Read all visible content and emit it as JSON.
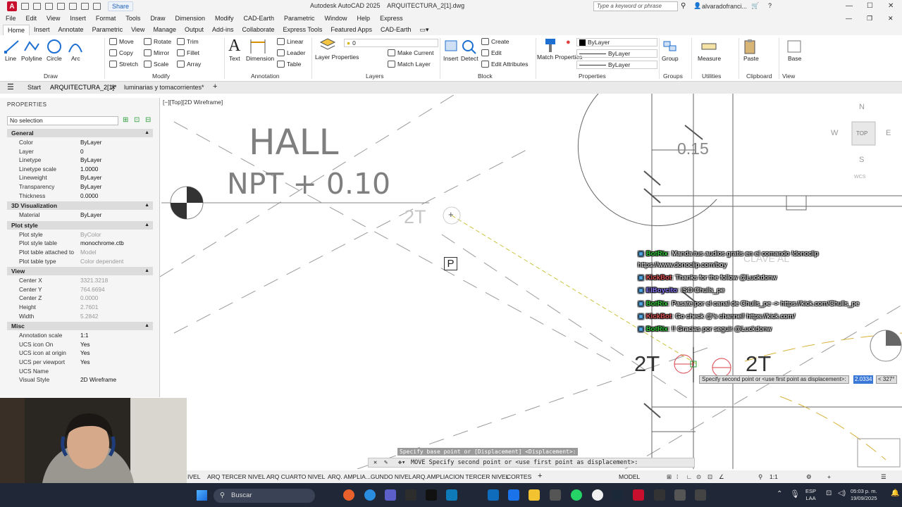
{
  "window": {
    "title": "Autodesk AutoCAD 2025    ARQUITECTURA_2[1].dwg",
    "share_label": "Share",
    "search_placeholder": "Type a keyword or phrase",
    "user": "alvaradofranci..."
  },
  "menu": [
    "File",
    "Edit",
    "View",
    "Insert",
    "Format",
    "Tools",
    "Draw",
    "Dimension",
    "Modify",
    "CAD-Earth",
    "Parametric",
    "Window",
    "Help",
    "Express"
  ],
  "ribbon_tabs": [
    "Home",
    "Insert",
    "Annotate",
    "Parametric",
    "View",
    "Manage",
    "Output",
    "Add-ins",
    "Collaborate",
    "Express Tools",
    "Featured Apps",
    "CAD-Earth"
  ],
  "ribbon": {
    "draw": {
      "line": "Line",
      "polyline": "Polyline",
      "circle": "Circle",
      "arc": "Arc",
      "label": "Draw"
    },
    "modify": {
      "move": "Move",
      "rotate": "Rotate",
      "trim": "Trim",
      "copy": "Copy",
      "mirror": "Mirror",
      "fillet": "Fillet",
      "stretch": "Stretch",
      "scale": "Scale",
      "array": "Array",
      "label": "Modify"
    },
    "annotation": {
      "text": "Text",
      "dimension": "Dimension",
      "linear": "Linear",
      "leader": "Leader",
      "table": "Table",
      "label": "Annotation"
    },
    "layers": {
      "layer_properties": "Layer Properties",
      "layer_value": "0",
      "make_current": "Make Current",
      "match_layer": "Match Layer",
      "label": "Layers"
    },
    "block": {
      "insert": "Insert",
      "detect": "Detect",
      "create": "Create",
      "edit": "Edit",
      "edit_attributes": "Edit Attributes",
      "label": "Block"
    },
    "properties": {
      "match_properties": "Match Properties",
      "color": "ByLayer",
      "lineweight": "ByLayer",
      "linetype": "ByLayer",
      "label": "Properties"
    },
    "groups": {
      "group": "Group",
      "label": "Groups"
    },
    "utilities": {
      "measure": "Measure",
      "label": "Utilities"
    },
    "clipboard": {
      "paste": "Paste",
      "label": "Clipboard"
    },
    "view": {
      "base": "Base",
      "label": "View"
    }
  },
  "file_tabs": {
    "start": "Start",
    "active": "ARQUITECTURA_2[1]*",
    "other": "luminarias y tomacorrientes*"
  },
  "properties": {
    "title": "PROPERTIES",
    "selection": "No selection",
    "sections": [
      {
        "name": "General",
        "rows": [
          [
            "Color",
            "ByLayer"
          ],
          [
            "Layer",
            "0"
          ],
          [
            "Linetype",
            "ByLayer"
          ],
          [
            "Linetype scale",
            "1.0000"
          ],
          [
            "Lineweight",
            "ByLayer"
          ],
          [
            "Transparency",
            "ByLayer"
          ],
          [
            "Thickness",
            "0.0000"
          ]
        ]
      },
      {
        "name": "3D Visualization",
        "rows": [
          [
            "Material",
            "ByLayer"
          ]
        ]
      },
      {
        "name": "Plot style",
        "rows": [
          [
            "Plot style",
            "ByColor"
          ],
          [
            "Plot style table",
            "monochrome.ctb"
          ],
          [
            "Plot table attached to",
            "Model"
          ],
          [
            "Plot table type",
            "Color dependent"
          ]
        ]
      },
      {
        "name": "View",
        "rows": [
          [
            "Center X",
            "3321.3218"
          ],
          [
            "Center Y",
            "764.6694"
          ],
          [
            "Center Z",
            "0.0000"
          ],
          [
            "Height",
            "2.7601"
          ],
          [
            "Width",
            "5.2842"
          ]
        ]
      },
      {
        "name": "Misc",
        "rows": [
          [
            "Annotation scale",
            "1:1"
          ],
          [
            "UCS icon On",
            "Yes"
          ],
          [
            "UCS icon at origin",
            "Yes"
          ],
          [
            "UCS per viewport",
            "Yes"
          ],
          [
            "UCS Name",
            ""
          ],
          [
            "Visual Style",
            "2D Wireframe"
          ]
        ]
      }
    ]
  },
  "viewport": {
    "label": "[−][Top][2D Wireframe]",
    "hall": "HALL",
    "npt": "NPT + 0.10",
    "dim_015": "0.15",
    "tag_2t_a": "2T",
    "tag_2t_b": "2T",
    "tag_2t_c": "2T",
    "p_label": "P",
    "compass": {
      "n": "N",
      "s": "S",
      "e": "E",
      "w": "W",
      "top": "TOP",
      "wcs": "WCS"
    },
    "hidden_text": "CLAVE AL"
  },
  "chat": [
    {
      "user": "BotRix",
      "msg": ": Manda tus audios gratis en el comando !donoclip",
      "color": "#38d13f"
    },
    {
      "user": "",
      "msg": "https://www.donoclip.com/boy",
      "color": "#ffffff"
    },
    {
      "user": "KickBot",
      "msg": ": Thanks for the follow @Luckdonw",
      "color": "#e05555"
    },
    {
      "user": "ElBoycito",
      "msg": ": ISO Chulls_pe",
      "color": "#8a7bff"
    },
    {
      "user": "BotRix",
      "msg": ": Pasate por el canal de Chulls_pe -> https://kick.com/Chulls_pe",
      "color": "#38d13f"
    },
    {
      "user": "KickBot",
      "msg": ": Go check @'s channel! https://kick.com/",
      "color": "#e05555"
    },
    {
      "user": "BotRix",
      "msg": ": !! Gracias por seguir @Luckdonw",
      "color": "#38d13f"
    }
  ],
  "command": {
    "base_point": "Specify base point or [Displacement] <Displacement>:",
    "current": "MOVE Specify second point or <use first point as displacement>:",
    "dyn_prompt": "Specify second point or <use first point as displacement>:",
    "dyn_value": "2.0334",
    "dyn_angle": "< 327°"
  },
  "layout_tabs": [
    "IVEL",
    "ARQ TERCER NIVEL",
    "ARQ CUARTO NIVEL",
    "ARQ. AMPLIA...GUNDO NIVEL",
    "ARQ.AMPLIACION TERCER NIVEL",
    "CORTES"
  ],
  "status": {
    "model": "MODEL",
    "scale": "1:1"
  },
  "taskbar": {
    "search": "Buscar",
    "lang": "ESP",
    "lang2": "LAA",
    "time": "05:03 p. m.",
    "date": "19/09/2025"
  }
}
